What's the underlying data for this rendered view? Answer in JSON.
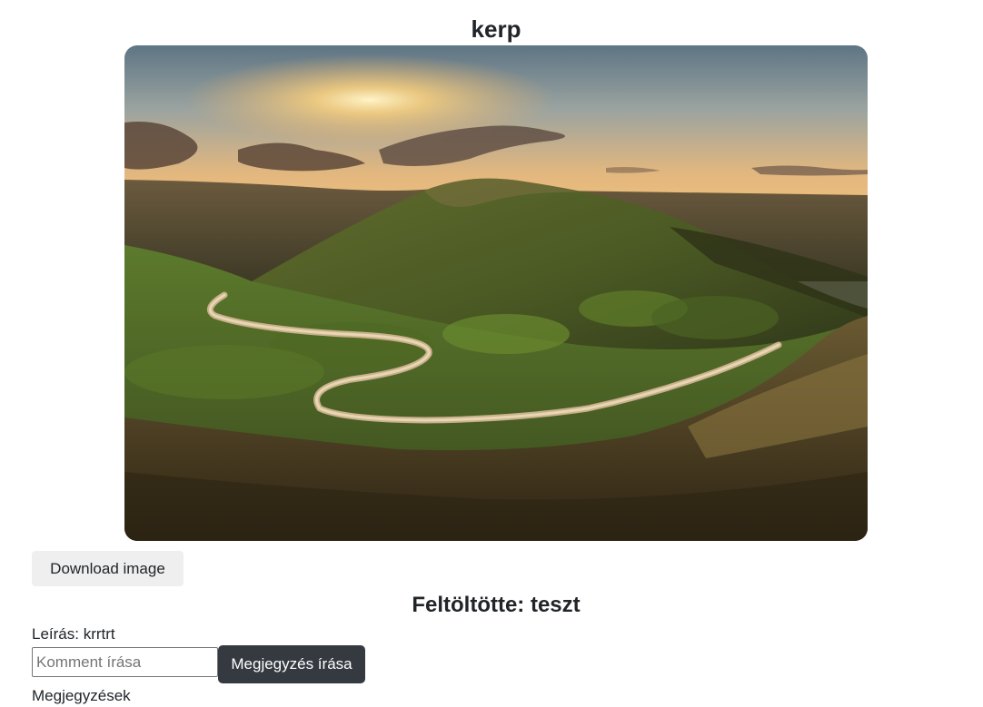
{
  "post": {
    "title": "kerp",
    "image_alt": "Sunset over winding road through green hills",
    "download_label": "Download image",
    "uploader_text": "Feltöltötte: teszt",
    "description_text": "Leírás: krrtrt"
  },
  "comment_form": {
    "placeholder": "Komment írása",
    "value": "",
    "submit_label": "Megjegyzés írása"
  },
  "comments": {
    "heading": "Megjegyzések"
  },
  "colors": {
    "submit_bg": "#343a40",
    "download_bg": "#efefef",
    "text": "#212529"
  }
}
